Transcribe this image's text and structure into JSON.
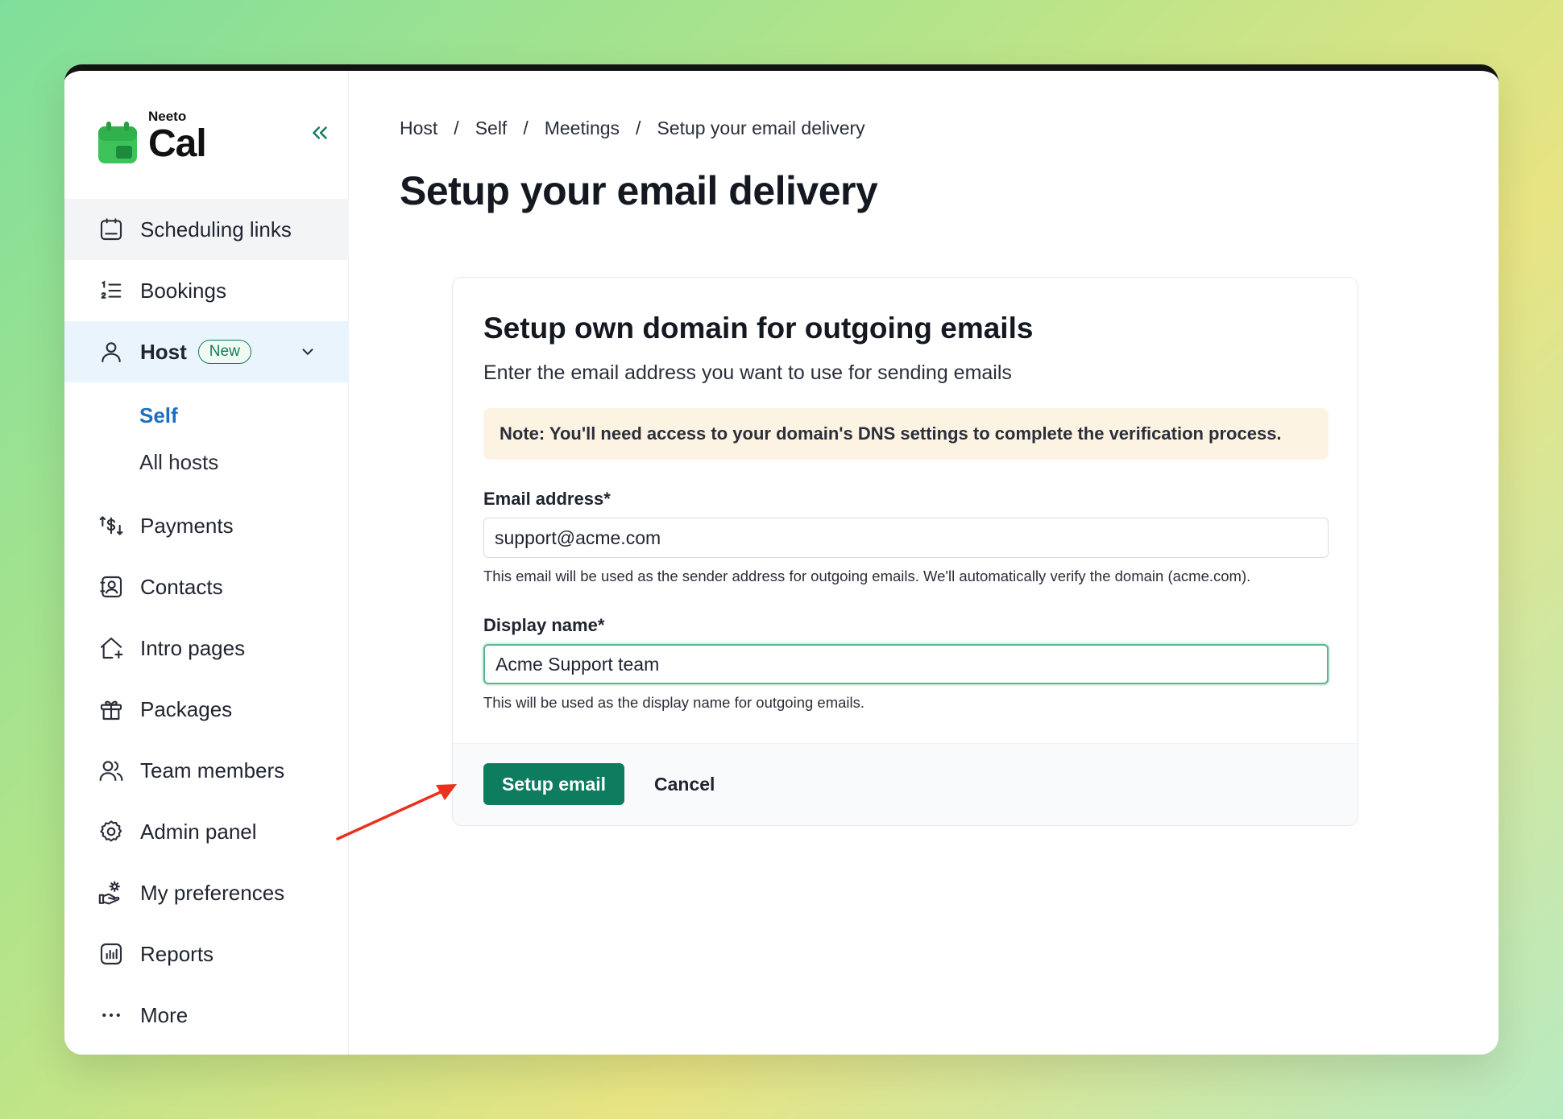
{
  "app": {
    "logo_small": "Neeto",
    "logo_big": "Cal",
    "brand_color": "#0e7c5f"
  },
  "sidebar": {
    "items": [
      {
        "label": "Scheduling links",
        "icon": "calendar-icon"
      },
      {
        "label": "Bookings",
        "icon": "numbered-list-icon"
      },
      {
        "label": "Host",
        "icon": "user-icon",
        "badge": "New"
      },
      {
        "label": "Payments",
        "icon": "payments-icon"
      },
      {
        "label": "Contacts",
        "icon": "contacts-icon"
      },
      {
        "label": "Intro pages",
        "icon": "home-plus-icon"
      },
      {
        "label": "Packages",
        "icon": "gift-icon"
      },
      {
        "label": "Team members",
        "icon": "team-icon"
      },
      {
        "label": "Admin panel",
        "icon": "gear-icon"
      },
      {
        "label": "My preferences",
        "icon": "preferences-icon"
      },
      {
        "label": "Reports",
        "icon": "reports-icon"
      },
      {
        "label": "More",
        "icon": "more-dots-icon"
      }
    ],
    "host_sub": [
      {
        "label": "Self",
        "active": true
      },
      {
        "label": "All hosts",
        "active": false
      }
    ]
  },
  "breadcrumb": [
    "Host",
    "Self",
    "Meetings",
    "Setup your email delivery"
  ],
  "breadcrumb_sep": "/",
  "page_title": "Setup your email delivery",
  "card": {
    "title": "Setup own domain for outgoing emails",
    "subtitle": "Enter the email address you want to use for sending emails",
    "note": "Note: You'll need access to your domain's DNS settings to complete the verification process.",
    "email": {
      "label": "Email address*",
      "value": "support@acme.com",
      "help": "This email will be used as the sender address for outgoing emails. We'll automatically verify the domain (acme.com)."
    },
    "display_name": {
      "label": "Display name*",
      "value": "Acme Support team",
      "help": "This will be used as the display name for outgoing emails."
    },
    "primary_button": "Setup email",
    "cancel_button": "Cancel"
  }
}
